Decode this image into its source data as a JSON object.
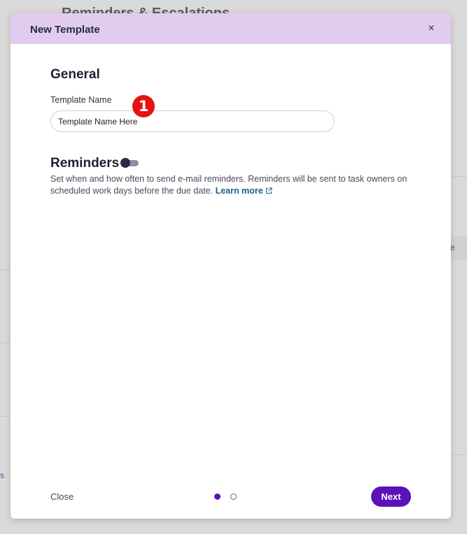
{
  "background": {
    "title": "Reminders & Escalations",
    "right_text": "e",
    "left_text": "s"
  },
  "modal": {
    "title": "New Template",
    "close_glyph": "×",
    "general": {
      "heading": "General",
      "template_name_label": "Template Name",
      "template_name_value": "Template Name Here",
      "badge_number": "1"
    },
    "reminders": {
      "heading": "Reminders",
      "toggle_on": false,
      "description": "Set when and how often to send e-mail reminders. Reminders will be sent to task owners on scheduled work days before the due date.",
      "learn_more": "Learn more"
    },
    "footer": {
      "close_label": "Close",
      "current_step": 1,
      "total_steps": 2,
      "next_label": "Next"
    }
  },
  "colors": {
    "header_bg": "#e1ccf0",
    "accent": "#5b12b8",
    "link": "#1a5f8a",
    "badge": "#e81010"
  },
  "icons": [
    "close-icon",
    "external-link-icon",
    "toggle-switch"
  ]
}
